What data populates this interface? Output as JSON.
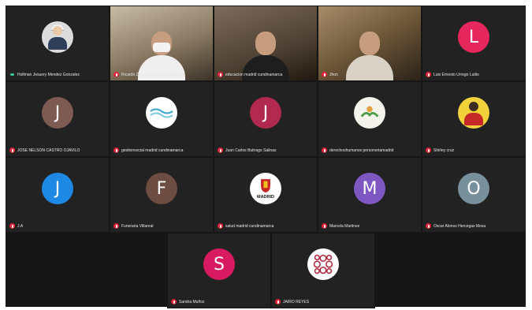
{
  "colors": {
    "background": "#161616",
    "tile": "#222222",
    "muted_mic": "#e0243a",
    "name_text": "#e8e8e8"
  },
  "participants": [
    {
      "id": "p1",
      "name": "Hollman Jesuery Mendez Gonzalez",
      "avatar_type": "photo",
      "mic": "on"
    },
    {
      "id": "p2",
      "name": "Ricardo Zaa Javier Alarcón Sabogal",
      "avatar_type": "video",
      "mic": "muted"
    },
    {
      "id": "p3",
      "name": "educacion madrid cundinamarca",
      "avatar_type": "video",
      "mic": "muted"
    },
    {
      "id": "p4",
      "name": "Jhon",
      "avatar_type": "video",
      "mic": "muted"
    },
    {
      "id": "p5",
      "name": "Luis Ernesto Urrego Lutilo",
      "avatar_type": "letter",
      "letter": "L",
      "color": "#e6275d",
      "mic": "muted"
    },
    {
      "id": "p6",
      "name": "JOSE NELSON CASTRO OJAVILO",
      "avatar_type": "letter",
      "letter": "J",
      "color": "#7d5b52",
      "mic": "muted"
    },
    {
      "id": "p7",
      "name": "gestionsocial madrid cundinamarca",
      "avatar_type": "logo-wave",
      "mic": "muted"
    },
    {
      "id": "p8",
      "name": "Juan Carlos Buitrago Salinas",
      "avatar_type": "letter",
      "letter": "J",
      "color": "#b2294f",
      "mic": "muted"
    },
    {
      "id": "p9",
      "name": "derechoshumanos personeriamadrid",
      "avatar_type": "logo-hands",
      "mic": "muted"
    },
    {
      "id": "p10",
      "name": "Shirley cruz",
      "avatar_type": "photo",
      "mic": "muted"
    },
    {
      "id": "p11",
      "name": "J.A",
      "avatar_type": "letter",
      "letter": "J",
      "color": "#1e88e5",
      "mic": "muted"
    },
    {
      "id": "p12",
      "name": "Funeraria Villareal",
      "avatar_type": "letter",
      "letter": "F",
      "color": "#6d4c41",
      "mic": "muted"
    },
    {
      "id": "p13",
      "name": "salud madrid cundinamarca",
      "avatar_type": "logo-madrid",
      "logo_text": "MADRID",
      "mic": "muted"
    },
    {
      "id": "p14",
      "name": "Marcela Martinez",
      "avatar_type": "letter",
      "letter": "M",
      "color": "#7e57c2",
      "mic": "muted"
    },
    {
      "id": "p15",
      "name": "Oscar Alonso Hercegas Mesa",
      "avatar_type": "letter",
      "letter": "O",
      "color": "#78909c",
      "mic": "muted"
    },
    {
      "id": "p16",
      "name": "Sandra Muñoz",
      "avatar_type": "letter",
      "letter": "S",
      "color": "#d81b60",
      "mic": "muted"
    },
    {
      "id": "p17",
      "name": "JAIRO REYES",
      "avatar_type": "logo-ball",
      "mic": "muted"
    }
  ]
}
